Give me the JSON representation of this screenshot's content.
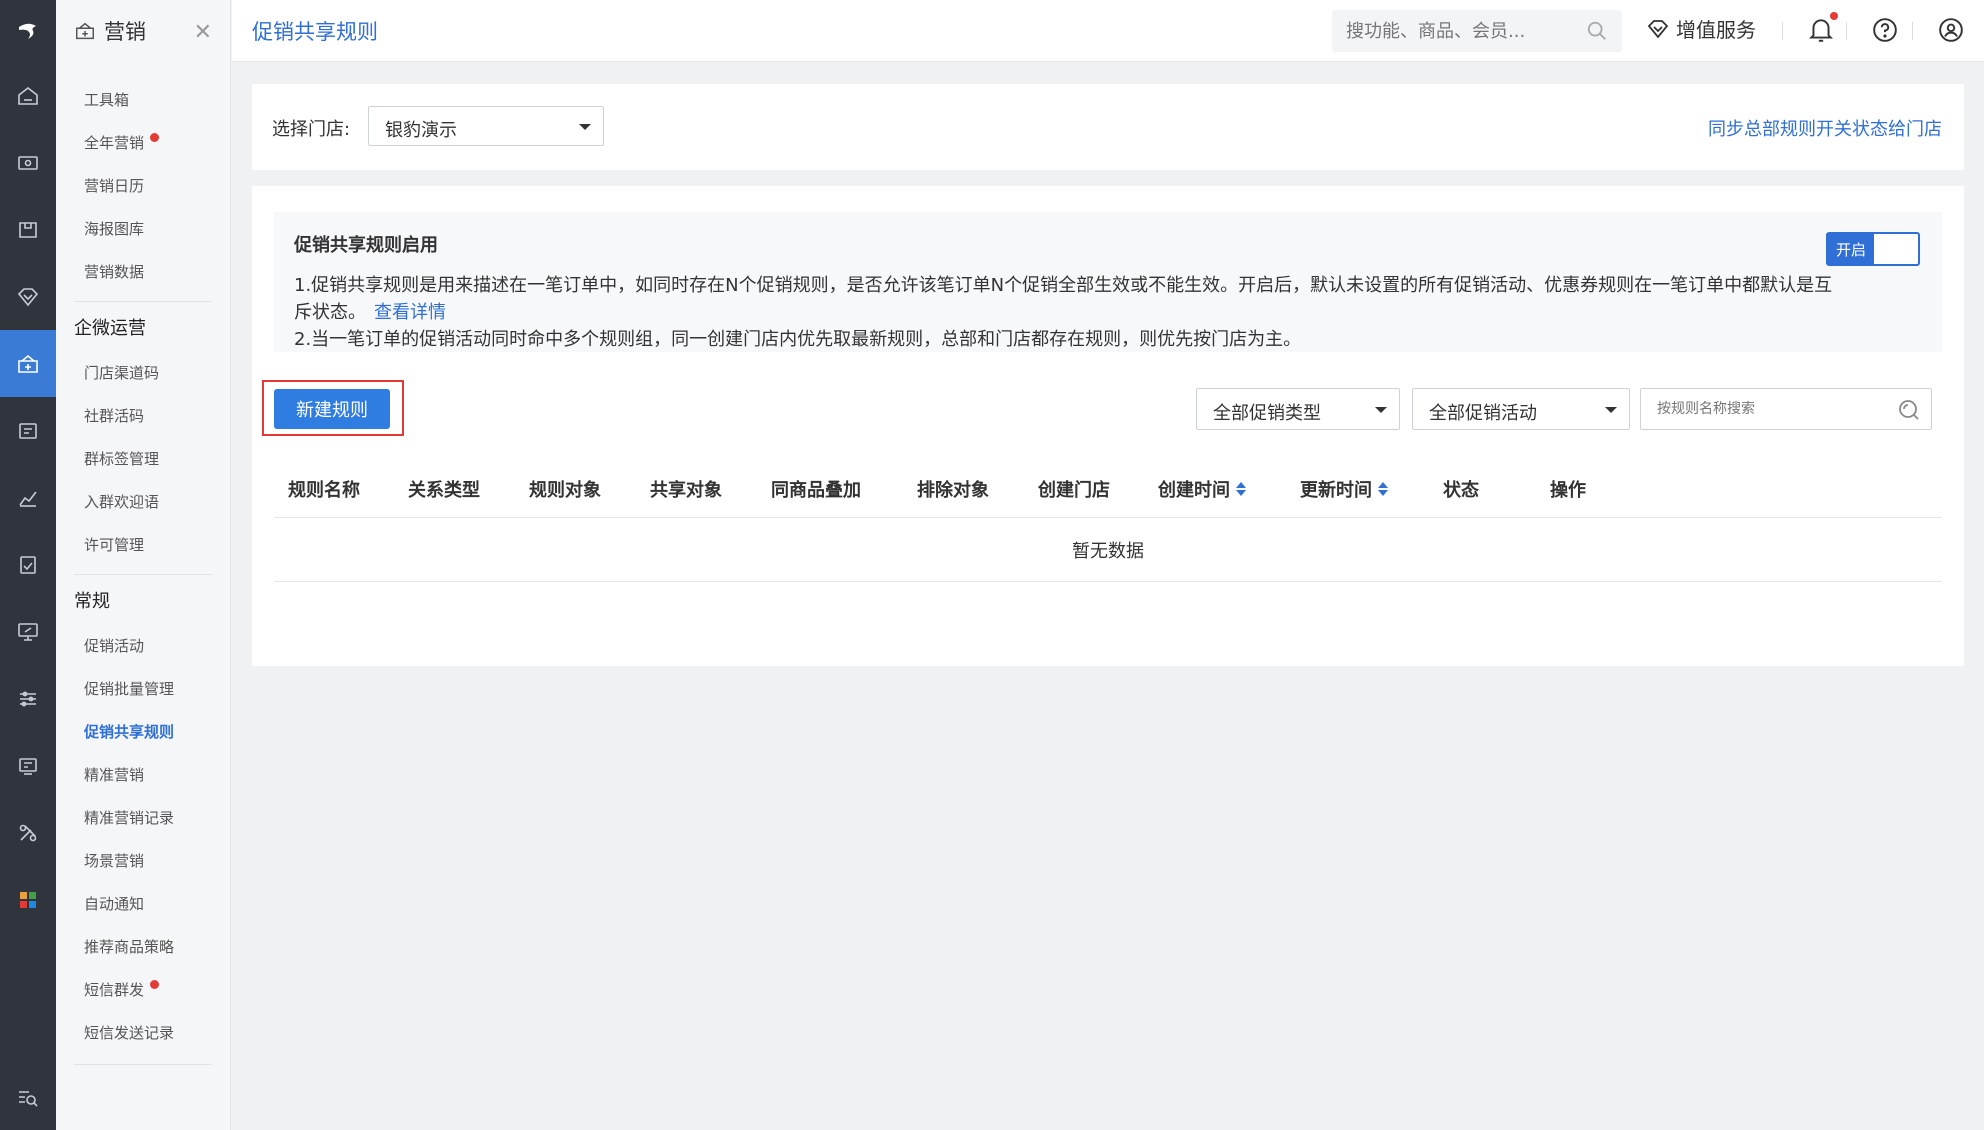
{
  "sidebar": {
    "module_title": "营销",
    "items_group1": [
      {
        "label": "工具箱",
        "dot": false
      },
      {
        "label": "全年营销",
        "dot": true
      },
      {
        "label": "营销日历",
        "dot": false
      },
      {
        "label": "海报图库",
        "dot": false
      },
      {
        "label": "营销数据",
        "dot": false
      }
    ],
    "group2_title": "企微运营",
    "items_group2": [
      {
        "label": "门店渠道码"
      },
      {
        "label": "社群活码"
      },
      {
        "label": "群标签管理"
      },
      {
        "label": "入群欢迎语"
      },
      {
        "label": "许可管理"
      }
    ],
    "group3_title": "常规",
    "items_group3": [
      {
        "label": "促销活动"
      },
      {
        "label": "促销批量管理"
      },
      {
        "label": "促销共享规则",
        "active": true
      },
      {
        "label": "精准营销"
      },
      {
        "label": "精准营销记录"
      },
      {
        "label": "场景营销"
      },
      {
        "label": "自动通知"
      },
      {
        "label": "推荐商品策略"
      },
      {
        "label": "短信群发",
        "dot": true
      },
      {
        "label": "短信发送记录"
      }
    ]
  },
  "header": {
    "page_title": "促销共享规则",
    "search_placeholder": "搜功能、商品、会员...",
    "value_added": "增值服务"
  },
  "store": {
    "label": "选择门店:",
    "selected": "银豹演示",
    "sync_link": "同步总部规则开关状态给门店"
  },
  "notice": {
    "title": "促销共享规则启用",
    "line1": "1.促销共享规则是用来描述在一笔订单中，如同时存在N个促销规则，是否允许该笔订单N个促销全部生效或不能生效。开启后，默认未设置的所有促销活动、优惠券规则在一笔订单中都默认是互",
    "line1b": "斥状态。",
    "detail_link": "查看详情",
    "line2": "2.当一笔订单的促销活动同时命中多个规则组，同一创建门店内优先取最新规则，总部和门店都存在规则，则优先按门店为主。",
    "toggle_label": "开启"
  },
  "toolbar": {
    "new_rule": "新建规则",
    "filter_type": "全部促销类型",
    "filter_activity": "全部促销活动",
    "name_search_placeholder": "按规则名称搜索"
  },
  "table": {
    "columns": [
      "规则名称",
      "关系类型",
      "规则对象",
      "共享对象",
      "同商品叠加",
      "排除对象",
      "创建门店",
      "创建时间",
      "更新时间",
      "状态",
      "操作"
    ],
    "empty_text": "暂无数据"
  },
  "colors": {
    "accent": "#2f6fd6",
    "rail_bg": "#30343d",
    "highlight_border": "#e53935"
  }
}
